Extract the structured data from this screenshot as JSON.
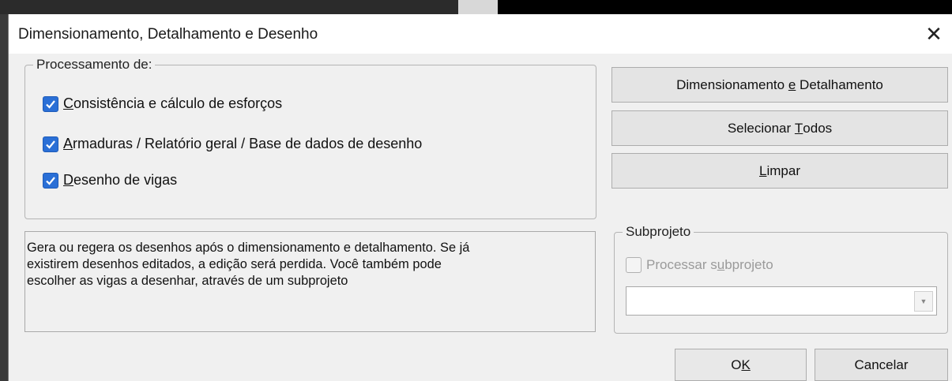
{
  "window": {
    "title": "Dimensionamento, Detalhamento e Desenho",
    "close_glyph": "✕"
  },
  "processing_group": {
    "legend": "Processamento de:",
    "options": [
      {
        "mnemonic": "C",
        "rest": "onsistência e cálculo de esforços",
        "checked": true
      },
      {
        "mnemonic": "A",
        "rest": "rmaduras / Relatório geral / Base de dados de desenho",
        "checked": true
      },
      {
        "mnemonic": "D",
        "rest": "esenho de vigas",
        "checked": true
      }
    ]
  },
  "description": {
    "line1": "Gera ou regera os desenhos após o dimensionamento e detalhamento. Se já",
    "line2": "existirem desenhos editados, a edição será perdida. Você também pode",
    "line3": "escolher as vigas a desenhar, através de um subprojeto"
  },
  "buttons": {
    "dim_det": {
      "pre": "Dimensionamento ",
      "mnemonic": "e",
      "post": " Detalhamento"
    },
    "select_all": {
      "pre": "Selecionar ",
      "mnemonic": "T",
      "post": "odos"
    },
    "clear": {
      "pre": "",
      "mnemonic": "L",
      "post": "impar"
    },
    "ok": {
      "pre": "O",
      "mnemonic": "K",
      "post": ""
    },
    "cancel": "Cancelar"
  },
  "subproject_group": {
    "legend": "Subprojeto",
    "checkbox": {
      "pre": "Processar s",
      "mnemonic": "u",
      "post": "bprojeto",
      "checked": false,
      "enabled": false
    },
    "combo_value": "",
    "combo_arrow_icon": "chevron-down-icon"
  },
  "colors": {
    "checkbox_checked": "#2a6fd6",
    "dialog_bg": "#f0f0f0",
    "titlebar_bg": "#ffffff"
  }
}
